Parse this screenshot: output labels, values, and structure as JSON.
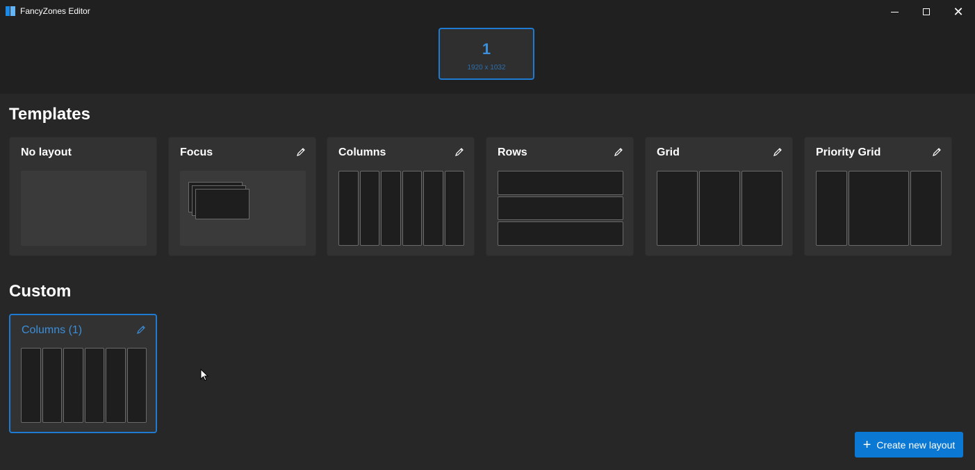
{
  "window": {
    "title": "FancyZones Editor"
  },
  "monitor": {
    "number": "1",
    "resolution": "1920 x 1032"
  },
  "sections": {
    "templates": "Templates",
    "custom": "Custom"
  },
  "templates": [
    {
      "title": "No layout",
      "editable": false,
      "type": "none"
    },
    {
      "title": "Focus",
      "editable": true,
      "type": "focus"
    },
    {
      "title": "Columns",
      "editable": true,
      "type": "columns",
      "zones": 6
    },
    {
      "title": "Rows",
      "editable": true,
      "type": "rows",
      "zones": 3
    },
    {
      "title": "Grid",
      "editable": true,
      "type": "grid",
      "zones": 3
    },
    {
      "title": "Priority Grid",
      "editable": true,
      "type": "priority-grid",
      "zones": 3
    }
  ],
  "custom": [
    {
      "title": "Columns (1)",
      "editable": true,
      "selected": true,
      "type": "columns",
      "zones": 6
    }
  ],
  "create_button": {
    "label": "Create new layout",
    "icon": "plus-icon"
  },
  "colors": {
    "accent": "#1f7ad1",
    "button": "#0b78d4",
    "background": "#202020",
    "card": "#323232"
  }
}
